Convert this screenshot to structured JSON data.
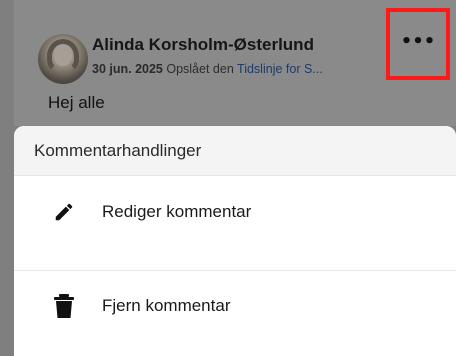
{
  "post": {
    "author_name": "Alinda Korsholm-Østerlund",
    "date": "30 jun. 2025",
    "posted_on_prefix": "Opslået den",
    "posted_on_link": "Tidslinje for S...",
    "text": "Hej alle",
    "more_icon": "more-horizontal-icon"
  },
  "sheet": {
    "title": "Kommentarhandlinger",
    "actions": [
      {
        "label": "Rediger kommentar",
        "icon": "pencil-icon"
      },
      {
        "label": "Fjern kommentar",
        "icon": "trash-icon"
      }
    ]
  },
  "highlight_color": "#ff1a1a"
}
